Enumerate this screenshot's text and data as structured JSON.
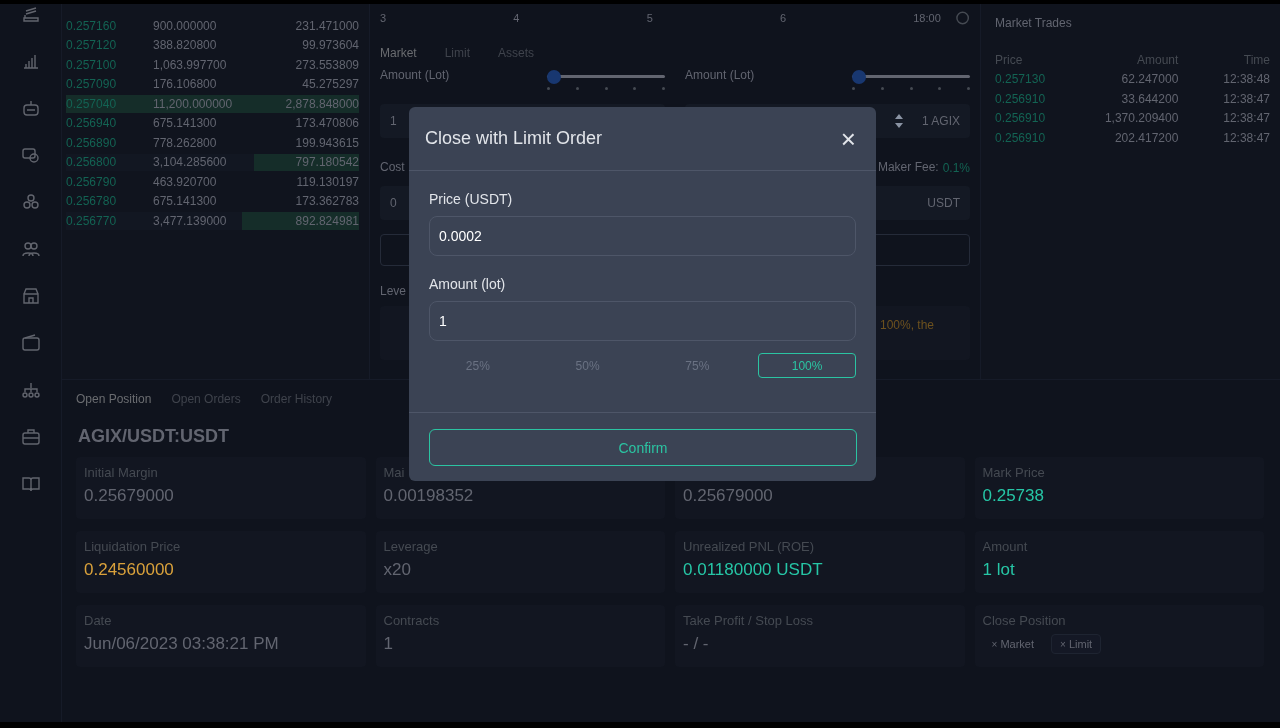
{
  "order_book": {
    "rows": [
      {
        "price": "0.257160",
        "amount": "900.000000",
        "total": "231.471000"
      },
      {
        "price": "0.257120",
        "amount": "388.820800",
        "total": "99.973604"
      },
      {
        "price": "0.257100",
        "amount": "1,063.997700",
        "total": "273.553809"
      },
      {
        "price": "0.257090",
        "amount": "176.106800",
        "total": "45.275297"
      },
      {
        "price": "0.257040",
        "amount": "11,200.000000",
        "total": "2,878.848000",
        "level": 1
      },
      {
        "price": "0.256940",
        "amount": "675.141300",
        "total": "173.470806"
      },
      {
        "price": "0.256890",
        "amount": "778.262800",
        "total": "199.943615"
      },
      {
        "price": "0.256800",
        "amount": "3,104.285600",
        "total": "797.180542",
        "level": 0.36
      },
      {
        "price": "0.256790",
        "amount": "463.920700",
        "total": "119.130197"
      },
      {
        "price": "0.256780",
        "amount": "675.141300",
        "total": "173.362783"
      },
      {
        "price": "0.256770",
        "amount": "3,477.139000",
        "total": "892.824981",
        "level": 0.4
      }
    ]
  },
  "chart_axis": {
    "labels": [
      "3",
      "4",
      "5",
      "6",
      "18:00"
    ]
  },
  "order_form": {
    "tabs": [
      {
        "label": "Market",
        "selected": true
      },
      {
        "label": "Limit",
        "selected": false
      },
      {
        "label": "Assets",
        "selected": false
      }
    ],
    "left": {
      "amount_label": "Amount (Lot)",
      "slider": {
        "level": 0
      },
      "amount_value": "1",
      "cost_label": "Cost",
      "cost_value": "0",
      "leverage_label": "Leve"
    },
    "right": {
      "amount_label": "Amount (Lot)",
      "slider": {
        "level": 0
      },
      "amount_unit": "1 AGIX",
      "fee_label": "Maker Fee:",
      "fee_value": "0.1%",
      "cost_unit": "USDT",
      "warning": "100%, the"
    }
  },
  "market_trades": {
    "title": "Market Trades",
    "columns": [
      "Price",
      "Amount",
      "Time"
    ],
    "rows": [
      {
        "price": "0.257130",
        "amount": "62.247000",
        "time": "12:38:48"
      },
      {
        "price": "0.256910",
        "amount": "33.644200",
        "time": "12:38:47"
      },
      {
        "price": "0.256910",
        "amount": "1,370.209400",
        "time": "12:38:47"
      },
      {
        "price": "0.256910",
        "amount": "202.417200",
        "time": "12:38:47"
      }
    ]
  },
  "position_tabs": [
    {
      "label": "Open Position",
      "selected": true
    },
    {
      "label": "Open Orders",
      "selected": false
    },
    {
      "label": "Order History",
      "selected": false
    }
  ],
  "position": {
    "symbol": "AGIX/USDT:USDT",
    "cards": [
      {
        "label": "Initial Margin",
        "value": "0.25679000"
      },
      {
        "label": "Mai",
        "value": "0.00198352"
      },
      {
        "value": "0.25679000"
      },
      {
        "label": "Mark Price",
        "value": "0.25738",
        "color": "#26c6a6"
      },
      {
        "label": "Liquidation Price",
        "value": "0.24560000",
        "color": "#d9a13b"
      },
      {
        "label": "Leverage",
        "value": "x20"
      },
      {
        "label": "Unrealized PNL (ROE)",
        "value": "0.01180000 USDT",
        "color": "#26c6a6"
      },
      {
        "label": "Amount",
        "value": "1 lot",
        "color": "#26c6a6"
      },
      {
        "label": "Date",
        "value": "Jun/06/2023 03:38:21 PM"
      },
      {
        "label": "Contracts",
        "value": "1"
      },
      {
        "label": "Take Profit / Stop Loss",
        "value": "- / -"
      },
      {
        "label": "Close Position",
        "buttons": [
          {
            "icon": "×",
            "label": "Market",
            "selected": false
          },
          {
            "icon": "×",
            "label": "Limit",
            "selected": true
          }
        ]
      }
    ]
  },
  "dialog": {
    "title": "Close with Limit Order",
    "close": "×",
    "fields": [
      {
        "label": "Price (USDT)",
        "value": "0.0002"
      },
      {
        "label": "Amount (lot)",
        "value": "1"
      }
    ],
    "percent_options": [
      {
        "label": "25%",
        "selected": false
      },
      {
        "label": "50%",
        "selected": false
      },
      {
        "label": "75%",
        "selected": false
      },
      {
        "label": "100%",
        "selected": true
      }
    ],
    "confirm": "Confirm"
  }
}
